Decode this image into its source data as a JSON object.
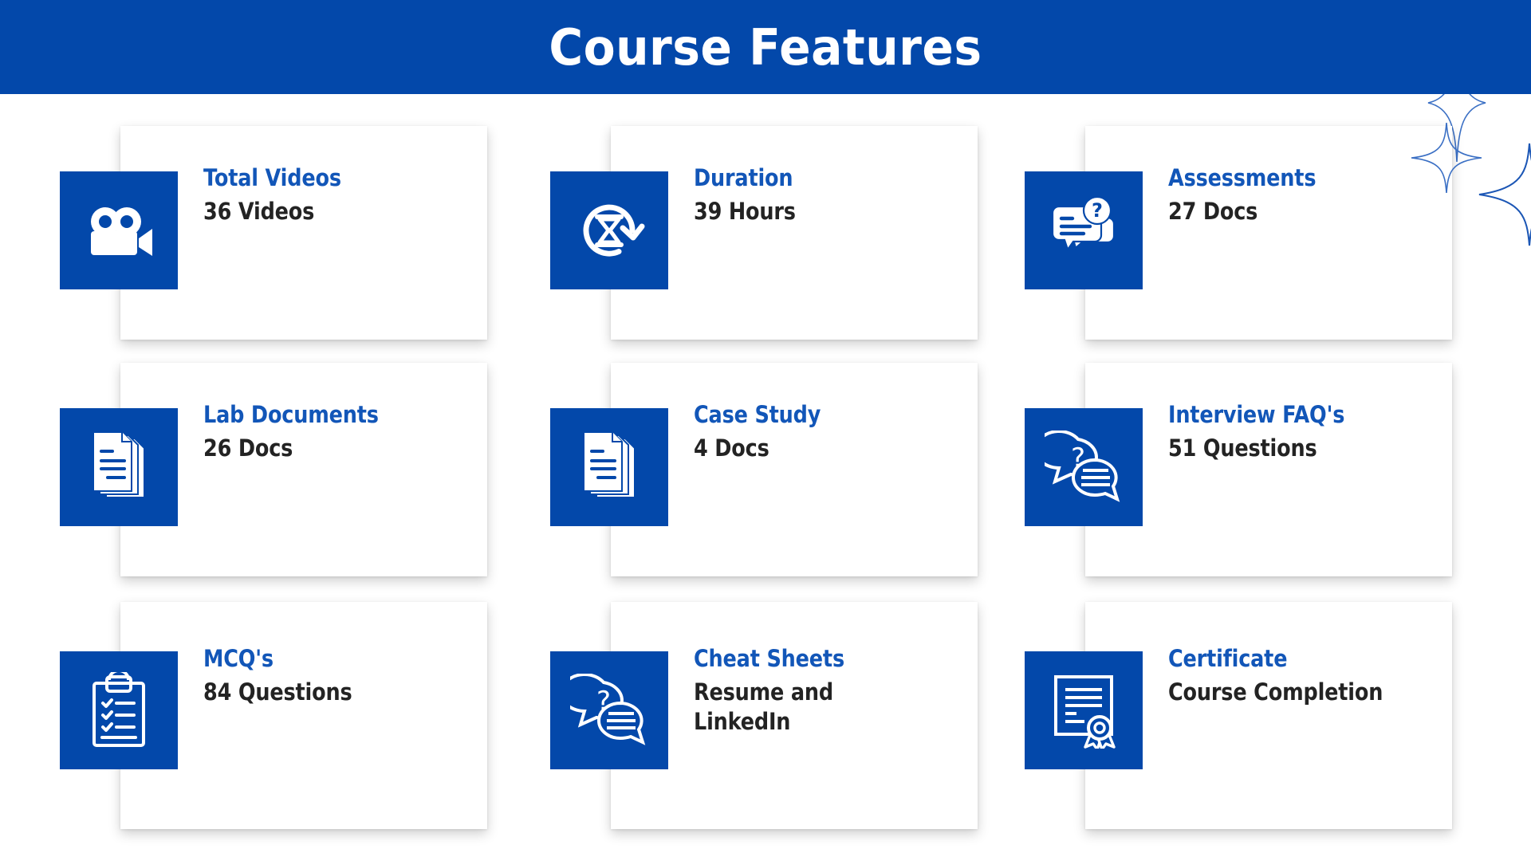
{
  "header": {
    "title": "Course Features",
    "background_color": "#0348aa",
    "text_color": "#ffffff"
  },
  "theme": {
    "brand_blue": "#0348aa",
    "title_blue": "#1256b8",
    "value_dark": "#232323",
    "card_background": "#ffffff",
    "page_background": "#ffffff"
  },
  "decorations": [
    {
      "name": "sparkle-top",
      "color": "#3a6fc4"
    },
    {
      "name": "sparkle-mid",
      "color": "#3a6fc4"
    },
    {
      "name": "sparkle-right",
      "color": "#1b56b5"
    }
  ],
  "features": [
    {
      "icon": "video-camera-icon",
      "title": "Total Videos",
      "value": "36 Videos"
    },
    {
      "icon": "hourglass-duration-icon",
      "title": "Duration",
      "value": "39 Hours"
    },
    {
      "icon": "assessment-chat-question-icon",
      "title": "Assessments",
      "value": "27 Docs"
    },
    {
      "icon": "documents-stack-icon",
      "title": "Lab Documents",
      "value": "26 Docs"
    },
    {
      "icon": "documents-stack-icon",
      "title": "Case Study",
      "value": "4 Docs"
    },
    {
      "icon": "chat-bubbles-question-icon",
      "title": "Interview FAQ's",
      "value": "51 Questions"
    },
    {
      "icon": "clipboard-checklist-icon",
      "title": "MCQ's",
      "value": "84 Questions"
    },
    {
      "icon": "chat-bubbles-question-icon",
      "title": "Cheat Sheets",
      "value": "Resume and LinkedIn"
    },
    {
      "icon": "certificate-ribbon-icon",
      "title": "Certificate",
      "value": "Course Completion"
    }
  ]
}
